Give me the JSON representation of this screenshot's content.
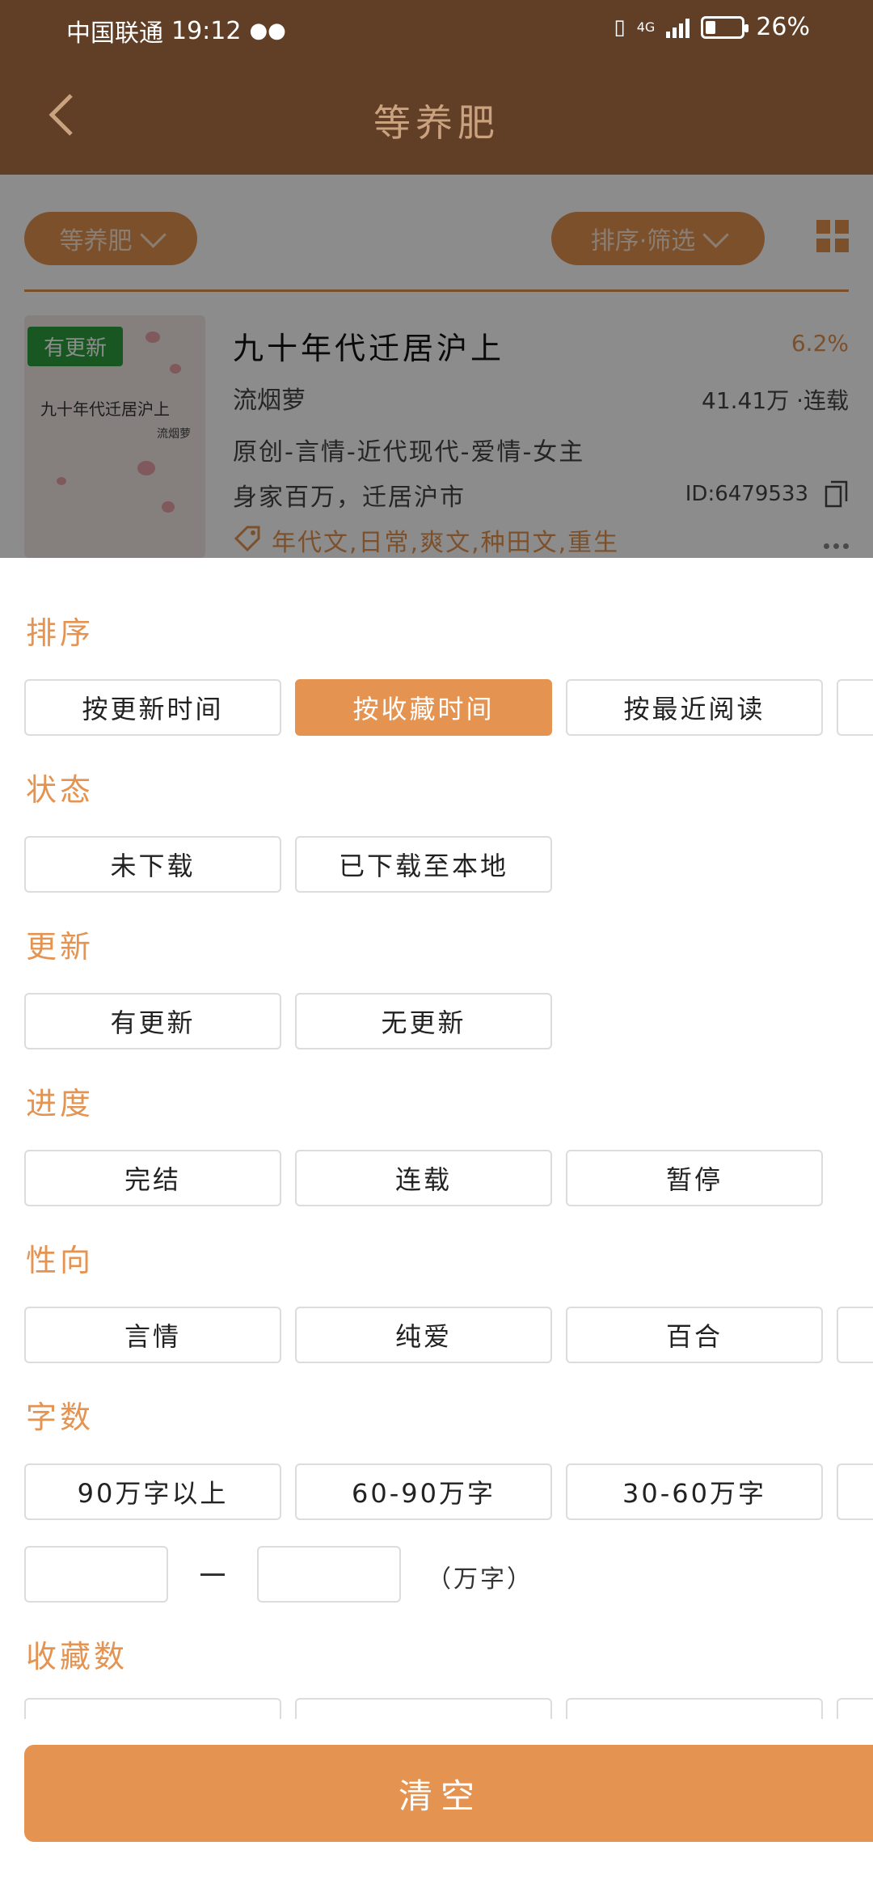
{
  "status_bar": {
    "carrier": "中国联通",
    "time": "19:12",
    "network": "4G",
    "battery": "26%"
  },
  "header": {
    "title": "等养肥"
  },
  "filters": {
    "category_pill": "等养肥",
    "sort_filter_pill": "排序·筛选"
  },
  "book": {
    "badge": "有更新",
    "cover_title": "九十年代迁居沪上",
    "cover_author": "流烟萝",
    "title": "九十年代迁居沪上",
    "progress": "6.2%",
    "author": "流烟萝",
    "words_status": "41.41万 ·连载",
    "tags": "原创-言情-近代现代-爱情-女主",
    "description": "身家百万，迁居沪市",
    "id": "ID:6479533",
    "keywords": "年代文,日常,爽文,种田文,重生"
  },
  "sheet": {
    "sections": [
      {
        "title": "排序",
        "options": [
          "按更新时间",
          "按收藏时间",
          "按最近阅读"
        ],
        "selected": 1
      },
      {
        "title": "状态",
        "options": [
          "未下载",
          "已下载至本地"
        ]
      },
      {
        "title": "更新",
        "options": [
          "有更新",
          "无更新"
        ]
      },
      {
        "title": "进度",
        "options": [
          "完结",
          "连载",
          "暂停"
        ]
      },
      {
        "title": "性向",
        "options": [
          "言情",
          "纯爱",
          "百合"
        ]
      },
      {
        "title": "字数",
        "options": [
          "90万字以上",
          "60-90万字",
          "30-60万字"
        ]
      },
      {
        "title": "收藏数",
        "options": []
      }
    ],
    "word_unit": "（万字）",
    "clear_button": "清空"
  },
  "colors": {
    "header_bg": "#613f26",
    "accent": "#e49350",
    "badge_green": "#2e9e3e"
  }
}
